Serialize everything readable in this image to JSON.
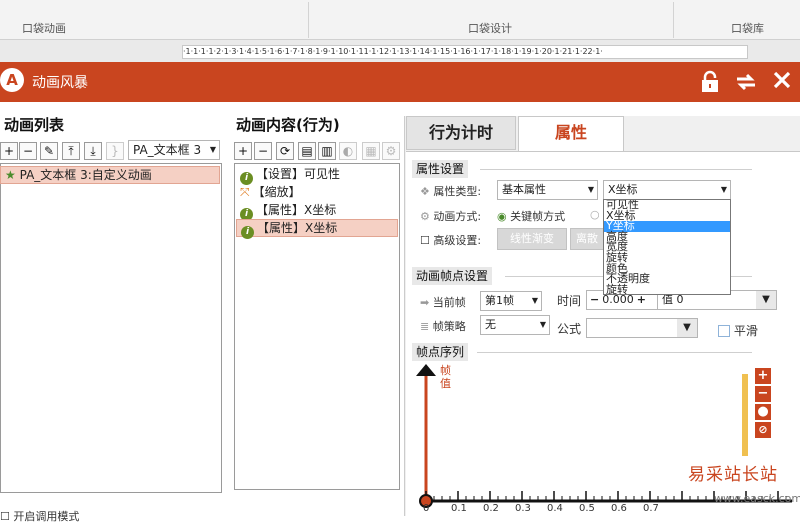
{
  "ribbon": {
    "groups": [
      "口袋动画",
      "口袋设计",
      "口袋库"
    ],
    "ruler_text": "·1·1·1·1·2·1·3·1·4·1·5·1·6·1·7·1·8·1·9·1·10·1·11·1·12·1·13·1·14·1·15·1·16·1·17·1·18·1·19·1·20·1·21·1·22·1·"
  },
  "window": {
    "logo": "A",
    "title": "动画风暴",
    "icons": [
      "lock-icon",
      "refresh-icon",
      "close-icon"
    ]
  },
  "left_panel": {
    "title": "动画列表",
    "toolbar_icons": [
      "plus-icon",
      "minus-icon",
      "brush-icon",
      "move-top-icon",
      "move-bottom-icon",
      "bracket-icon"
    ],
    "target_select": "PA_文本框 3",
    "items": [
      {
        "label": "PA_文本框 3:自定义动画",
        "selected": true
      }
    ]
  },
  "middle_panel": {
    "title": "动画内容(行为)",
    "items": [
      {
        "label": "【设置】可见性",
        "selected": false
      },
      {
        "label": "【缩放】",
        "selected": false
      },
      {
        "label": "【属性】X坐标",
        "selected": false
      },
      {
        "label": "【属性】X坐标",
        "selected": true
      }
    ]
  },
  "right_panel": {
    "tabs": [
      {
        "label": "行为计时",
        "active": false
      },
      {
        "label": "属性",
        "active": true
      }
    ],
    "property_settings": {
      "heading": "属性设置",
      "type_label": "属性类型:",
      "type_value": "基本属性",
      "property_value": "X坐标",
      "method_label": "动画方式:",
      "method_value": "关键帧方式",
      "advanced_label": "高级设置:",
      "btn_linear": "线性渐变",
      "btn_discrete": "离散"
    },
    "dropdown_options": [
      "可见性",
      "X坐标",
      "Y坐标",
      "高度",
      "宽度",
      "旋转",
      "颜色",
      "不透明度",
      "旋转"
    ],
    "dropdown_active_index": 2,
    "frame_settings": {
      "heading": "动画帧点设置",
      "current_frame_label": "当前帧",
      "current_frame_value": "第1帧",
      "time_label": "时间",
      "time_value": "0.000",
      "value_label": "值",
      "value_value": "0",
      "strategy_label": "帧策略",
      "strategy_value": "无",
      "formula_label": "公式",
      "smooth_label": "平滑"
    },
    "sequence": {
      "heading": "帧点序列",
      "y_label": "帧值",
      "x_ticks": [
        "0",
        "0.1",
        "0.2",
        "0.3",
        "0.4",
        "0.5",
        "0.6",
        "0.7"
      ]
    }
  },
  "footer": {
    "partial_text": "开启调用模式"
  },
  "watermark": {
    "site": "易采站长站",
    "url": "www.easck.com"
  }
}
